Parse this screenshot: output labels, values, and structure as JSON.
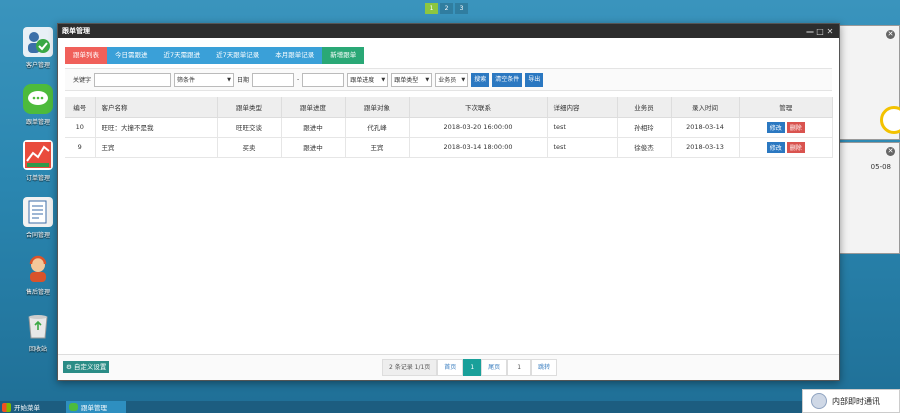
{
  "workspaces": [
    "1",
    "2",
    "3"
  ],
  "desktop_icons": [
    {
      "label": "客户管理"
    },
    {
      "label": "跟单管理"
    },
    {
      "label": "订单管理"
    },
    {
      "label": "合同管理"
    },
    {
      "label": "售后管理"
    },
    {
      "label": "回收站"
    }
  ],
  "bg_window": {
    "date_text": "05-08"
  },
  "window": {
    "title": "跟单管理",
    "controls": {
      "minimize": "—",
      "maximize": "□",
      "close": "✕"
    }
  },
  "tabs": [
    {
      "label": "跟单列表"
    },
    {
      "label": "今日需跟进"
    },
    {
      "label": "近7天需跟进"
    },
    {
      "label": "近7天跟单记录"
    },
    {
      "label": "本月跟单记录"
    },
    {
      "label": "新增跟单"
    }
  ],
  "filter": {
    "keyword_label": "关键字",
    "keyword_value": "",
    "condition_select": "筛条件",
    "date_label": "日期",
    "date_from": "",
    "date_sep": "-",
    "date_to": "",
    "progress_select": "跟单进度",
    "type_select": "跟单类型",
    "staff_select": "业务员",
    "search_btn": "搜索",
    "clear_btn": "清空条件",
    "export_btn": "导出"
  },
  "table": {
    "columns": [
      "编号",
      "客户名称",
      "跟单类型",
      "跟单进度",
      "跟单对象",
      "下次联系",
      "详细内容",
      "业务员",
      "录入时间",
      "管理"
    ],
    "rows": [
      {
        "id": "10",
        "customer": "旺旺：大撞不是我",
        "type": "旺旺交谈",
        "progress": "跟进中",
        "target": "代孔峰",
        "next": "2018-03-20 16:00:00",
        "detail": "test",
        "staff": "孙相玲",
        "created": "2018-03-14",
        "edit": "修改",
        "del": "删除"
      },
      {
        "id": "9",
        "customer": "王宾",
        "type": "买卖",
        "progress": "跟进中",
        "target": "王宾",
        "next": "2018-03-14 18:00:00",
        "detail": "test",
        "staff": "徐俊杰",
        "created": "2018-03-13",
        "edit": "修改",
        "del": "删除"
      }
    ]
  },
  "footer": {
    "custom_settings": "自定义设置",
    "pager_info": "2 条记录 1/1页",
    "first": "首页",
    "current": "1",
    "last": "尾页",
    "page_input": "1",
    "jump": "跳转"
  },
  "taskbar": {
    "start_label": "开始菜单",
    "task_label": "跟单管理",
    "im_label": "内部即时通讯"
  }
}
